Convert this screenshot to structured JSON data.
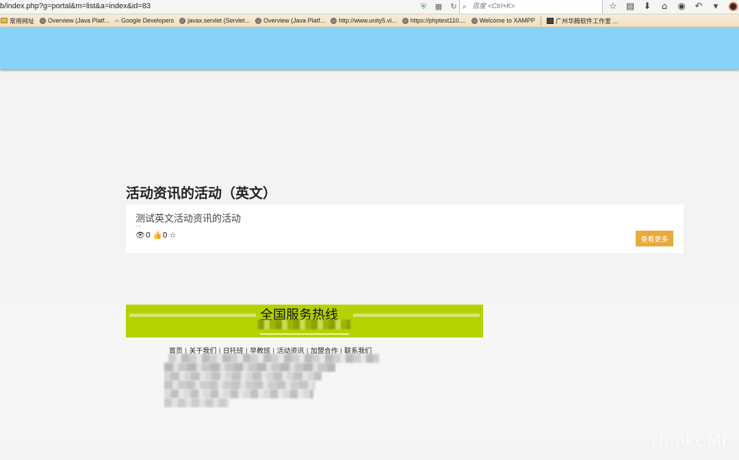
{
  "browser": {
    "url": "b/index.php?g=portal&m=list&a=index&id=83",
    "search_placeholder": "百度 <Ctrl+K>",
    "bookmarks": [
      "常用网址",
      "Overview (Java Platf...",
      "Google Developers",
      "javax.servlet (Servlet...",
      "Overview (Java Platf...",
      "http://www.unity5.vi...",
      "https://phptest110....",
      "Welcome to XAMPP",
      "广州华腾软件工作室 ..."
    ]
  },
  "page": {
    "title": "活动资讯的活动（英文）",
    "article": {
      "title": "测试英文活动资讯的活动",
      "excerpt": "...",
      "views": "0",
      "likes": "0",
      "more_label": "查看更多"
    },
    "footer": {
      "hotline_title": "全国服务热线",
      "nav": [
        "首页",
        "关于我们",
        "日托班",
        "早教班",
        "活动资讯",
        "加盟合作",
        "联系我们"
      ]
    },
    "watermark": "ThinkCMF"
  },
  "colors": {
    "header": "#87d3f8",
    "hotline": "#b5d200",
    "button": "#e8aa3b",
    "page_bg": "#f3f3f3"
  }
}
